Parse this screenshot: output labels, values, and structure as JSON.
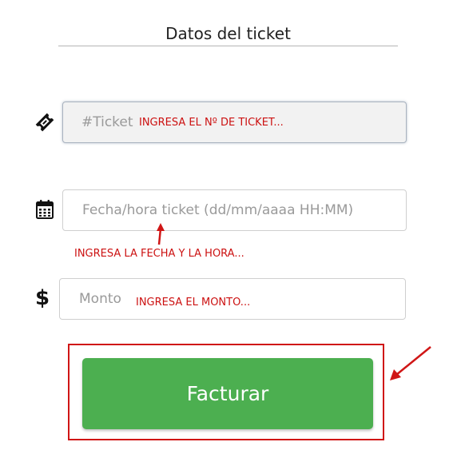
{
  "section": {
    "title": "Datos del ticket"
  },
  "fields": {
    "ticket": {
      "placeholder": "#Ticket",
      "value": "",
      "icon": "ticket-icon",
      "annotation": "INGRESA EL Nº DE TICKET..."
    },
    "datetime": {
      "placeholder": "Fecha/hora ticket (dd/mm/aaaa HH:MM)",
      "value": "",
      "icon": "calendar-icon",
      "annotation": "INGRESA LA FECHA Y LA HORA..."
    },
    "amount": {
      "placeholder": "Monto",
      "value": "",
      "icon": "dollar-icon",
      "annotation": "INGRESA EL MONTO..."
    }
  },
  "submit": {
    "label": "Facturar"
  },
  "colors": {
    "accent_green": "#4caf50",
    "annotation_red": "#cc1111",
    "highlight_red": "#d01616"
  }
}
